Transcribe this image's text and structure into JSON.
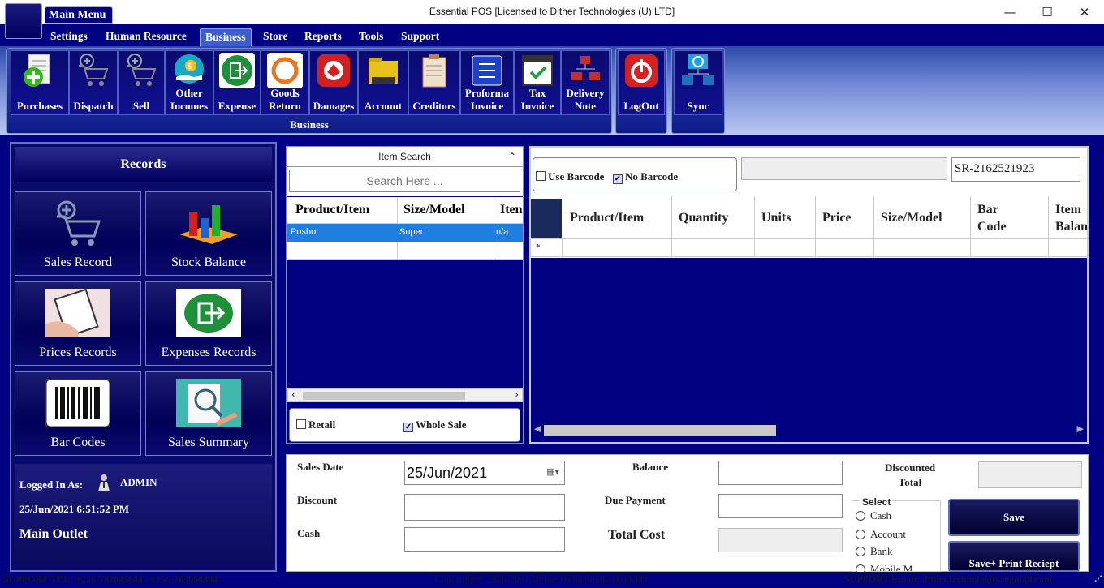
{
  "window": {
    "title": "Essential POS [Licensed to Dither Technologies (U) LTD]",
    "minimize": "—",
    "maximize": "☐",
    "close": "✕"
  },
  "main_menu_label": "Main Menu",
  "menu": [
    "Settings",
    "Human Resource",
    "Business",
    "Store",
    "Reports",
    "Tools",
    "Support"
  ],
  "ribbon": {
    "group_label": "Business",
    "buttons": [
      {
        "line1": "Purchases",
        "line2": ""
      },
      {
        "line1": "Dispatch",
        "line2": ""
      },
      {
        "line1": "Sell",
        "line2": ""
      },
      {
        "line1": "Other",
        "line2": "Incomes"
      },
      {
        "line1": "Expense",
        "line2": ""
      },
      {
        "line1": "Goods",
        "line2": "Return"
      },
      {
        "line1": "Damages",
        "line2": ""
      },
      {
        "line1": "Account",
        "line2": ""
      },
      {
        "line1": "Creditors",
        "line2": ""
      },
      {
        "line1": "Proforma",
        "line2": "Invoice"
      },
      {
        "line1": "Tax",
        "line2": "Invoice"
      },
      {
        "line1": "Delivery",
        "line2": "Note"
      }
    ],
    "logout": "LogOut",
    "sync": "Sync"
  },
  "records": {
    "header": "Records",
    "tiles": [
      "Sales Record",
      "Stock Balance",
      "Prices Records",
      "Expenses Records",
      "Bar Codes",
      "Sales Summary"
    ],
    "logged_in_label": "Logged In As:",
    "user": "ADMIN",
    "datetime": "25/Jun/2021 6:51:52 PM",
    "outlet": "Main Outlet"
  },
  "item_search": {
    "title": "Item Search",
    "collapse": "⌃",
    "placeholder": "Search Here ...",
    "columns": [
      "Product/Item",
      "Size/Model",
      "Iten"
    ],
    "rows": [
      [
        "Posho",
        "Super",
        "n/a"
      ]
    ],
    "retail_label": "Retail",
    "wholesale_label": "Whole Sale"
  },
  "cart": {
    "use_barcode_label": "Use Barcode",
    "no_barcode_label": "No Barcode",
    "receipt_no": "SR-2162521923",
    "columns": [
      "Product/Item",
      "Quantity",
      "Units",
      "Price",
      "Size/Model",
      "Bar Code",
      "Item Balan"
    ],
    "new_row_marker": "*"
  },
  "bottom": {
    "sales_date_label": "Sales Date",
    "sales_date": "25/Jun/2021",
    "discount_label": "Discount",
    "cash_label": "Cash",
    "balance_label": "Balance",
    "due_payment_label": "Due Payment",
    "total_cost_label": "Total Cost",
    "discounted_total_label": "Discounted Total",
    "select_label": "Select",
    "payment_options": [
      "Cash",
      "Account",
      "Bank",
      "Mobile M"
    ],
    "save": "Save",
    "save_print": "Save+ Print Reciept"
  },
  "status": {
    "support_tel": "SUPPORT TEL: +256-782045644 / +256-703050394",
    "copyright": "Copyright ©  2016-2021 Dither Technologies (U) LTD",
    "support_email": "SUPPORT Email: dither.technologies@gmail.com"
  }
}
